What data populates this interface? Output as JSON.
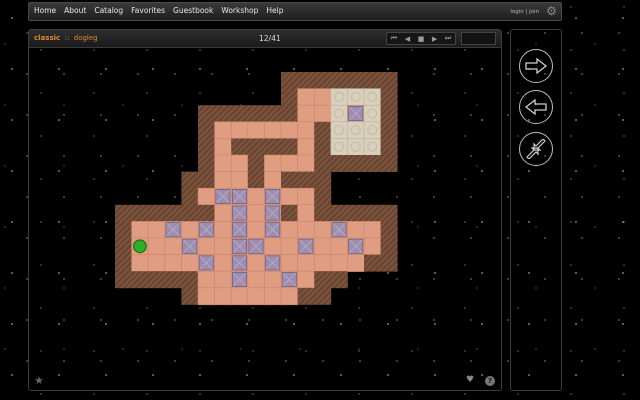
{
  "nav": {
    "items": [
      "Home",
      "About",
      "Catalog",
      "Favorites",
      "Guestbook",
      "Workshop",
      "Help"
    ],
    "login": "login | join"
  },
  "game": {
    "collection": "classic",
    "separator": "::",
    "level_name": "dogleg",
    "counter": "12/41"
  },
  "board": {
    "cols": 17,
    "rows": 14,
    "legend": {
      "#": "wall",
      ".": "floor",
      "G": "goal",
      "b": "box",
      "*": "box-on-goal",
      "@": "player",
      "-": "empty"
    },
    "rows_map": [
      "----------#######",
      "----------#..GGG#",
      "-----######..GbG#",
      "-----#......#GGG#",
      "-----#.####.#GGG#",
      "-----#..#...#####",
      "----##..#.###----",
      "----#.bb.b..#----",
      "######.b.b#.#####",
      "#..b.b.b.b...b..#",
      "#@..b..bb..b..b.#",
      "#....b.b.b.....##",
      "#####..b..b.##---",
      "----#......##----"
    ],
    "colors": {
      "wall": "#6e4a34",
      "floor": "#e09d82",
      "goal": "#d9cfbd",
      "box": "#9d8eb0",
      "player": "#2fae29"
    }
  }
}
